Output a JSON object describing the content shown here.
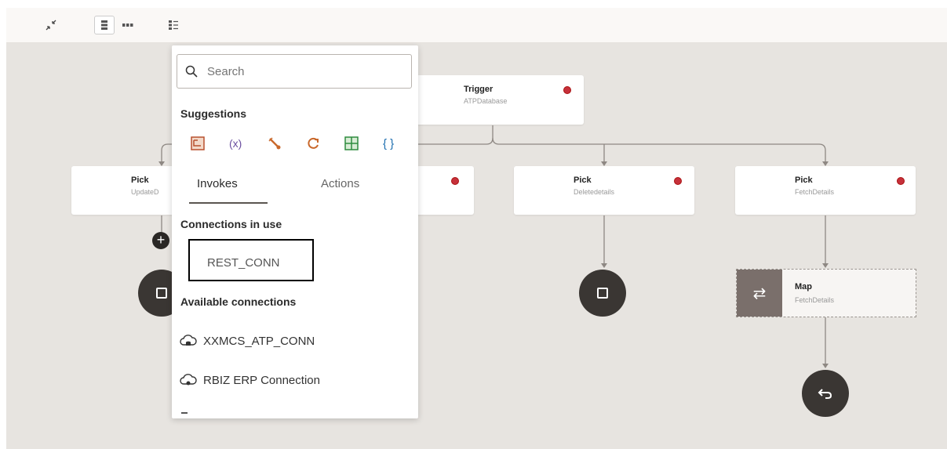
{
  "toolbar": {
    "collapse_icon": "collapse-arrows-icon",
    "vertical_layout_icon": "vertical-layout-icon",
    "horizontal_layout_icon": "horizontal-layout-icon",
    "pseudo_layout_icon": "pseudo-layout-icon"
  },
  "canvas": {
    "trigger": {
      "title": "Trigger",
      "subtitle": "ATPDatabase"
    },
    "pick_nodes": [
      {
        "title": "Pick",
        "subtitle": "UpdateD"
      },
      {
        "title": "Pick",
        "subtitle": "Deletedetails"
      },
      {
        "title": "Pick",
        "subtitle": "FetchDetails"
      }
    ],
    "map_node": {
      "title": "Map",
      "subtitle": "FetchDetails"
    }
  },
  "popup": {
    "search": {
      "placeholder": "Search",
      "value": ""
    },
    "suggestions_title": "Suggestions",
    "suggestions": [
      {
        "icon": "data-stitch-icon",
        "label": ""
      },
      {
        "icon": "variable-icon",
        "label": "(x)"
      },
      {
        "icon": "wrench-icon",
        "label": ""
      },
      {
        "icon": "loop-icon",
        "label": ""
      },
      {
        "icon": "table-icon",
        "label": ""
      },
      {
        "icon": "braces-icon",
        "label": "{ }"
      }
    ],
    "tabs": [
      {
        "label": "Invokes",
        "active": true
      },
      {
        "label": "Actions",
        "active": false
      }
    ],
    "connections_in_use_title": "Connections in use",
    "connections_in_use": [
      "REST_CONN"
    ],
    "available_connections_title": "Available connections",
    "available_connections": [
      "XXMCS_ATP_CONN",
      "RBIZ ERP Connection"
    ]
  },
  "colors": {
    "canvas_bg": "#e7e4e0",
    "error": "#c6303a",
    "dark_node": "#3a3633"
  }
}
